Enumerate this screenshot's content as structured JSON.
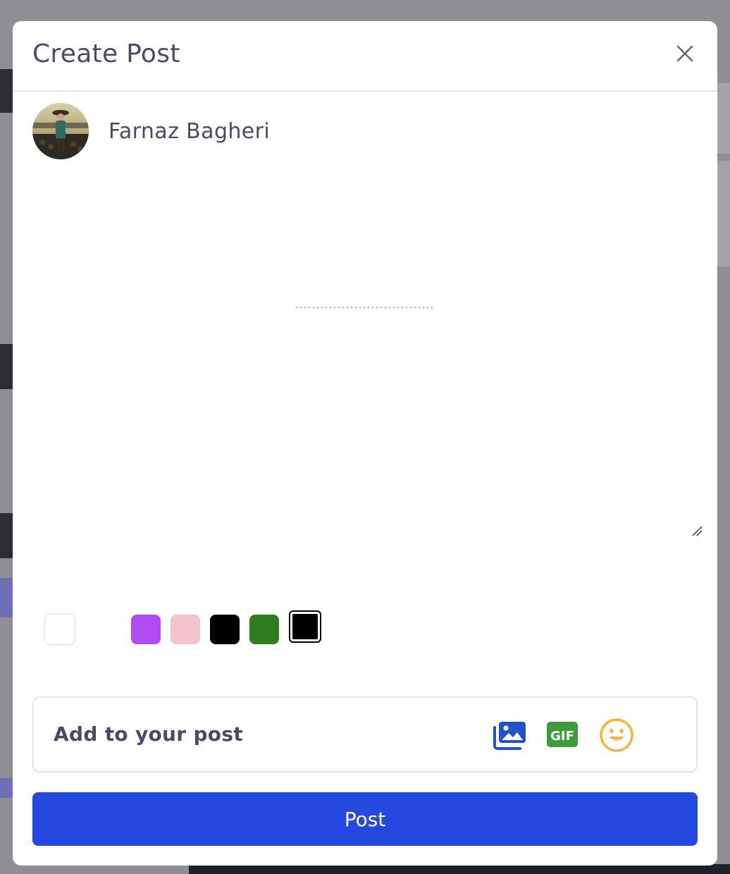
{
  "modal": {
    "title": "Create Post",
    "close_icon": "close-icon"
  },
  "user": {
    "name": "Farnaz Bagheri",
    "avatar_icon": "avatar"
  },
  "editor": {
    "value": "",
    "placeholder": ""
  },
  "swatches": [
    {
      "name": "white",
      "color": "#ffffff",
      "selected": false
    },
    {
      "name": "transparent",
      "color": "#ffffff",
      "selected": false
    },
    {
      "name": "purple",
      "color": "#b14cf5",
      "selected": false
    },
    {
      "name": "pink",
      "color": "#f4c4cc",
      "selected": false
    },
    {
      "name": "black",
      "color": "#000000",
      "selected": false
    },
    {
      "name": "green",
      "color": "#2f7d1f",
      "selected": false
    },
    {
      "name": "black-selected",
      "color": "#000000",
      "selected": true
    }
  ],
  "add_to_post": {
    "label": "Add to your post",
    "icons": [
      "photo-gallery-icon",
      "gif-icon",
      "emoji-icon"
    ]
  },
  "post_button": {
    "label": "Post",
    "color": "#2549e0"
  },
  "colors": {
    "title_text": "#4a4a66",
    "accent": "#2549e0"
  }
}
